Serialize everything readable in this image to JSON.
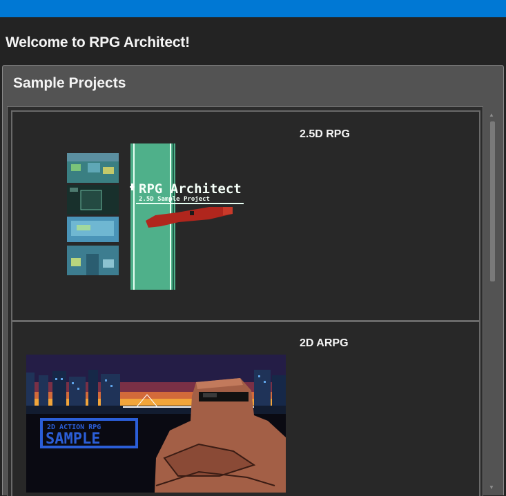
{
  "header": {
    "welcome_text": "Welcome to RPG Architect!"
  },
  "sample_projects": {
    "title": "Sample Projects",
    "items": [
      {
        "label": "2.5D RPG",
        "thumbnail_title": "RPG Architect",
        "thumbnail_subtitle": "2.5D Sample Project"
      },
      {
        "label": "2D ARPG",
        "thumbnail_title_top": "2D ACTION RPG",
        "thumbnail_title_bottom": "SAMPLE"
      }
    ]
  },
  "scrollbar": {
    "up_icon": "▲",
    "down_icon": "▼"
  },
  "colors": {
    "accent": "#0078d4",
    "window_bg": "#232323",
    "panel_bg": "#535353"
  }
}
